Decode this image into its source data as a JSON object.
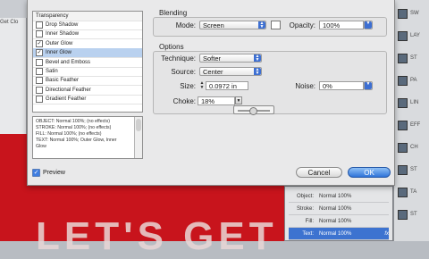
{
  "background": {
    "left_tab": "Get Clo",
    "big_text": "LET'S GET",
    "right_panel_items": [
      "SW",
      "LAY",
      "ST",
      "PA",
      "LIN",
      "EFF",
      "CH",
      "ST",
      "TA",
      "ST"
    ],
    "effects_panel": [
      {
        "label": "Object:",
        "value": "Normal 100%"
      },
      {
        "label": "Stroke:",
        "value": "Normal 100%"
      },
      {
        "label": "Fill:",
        "value": "Normal 100%"
      },
      {
        "label": "Text:",
        "value": "Normal 100%",
        "selected": true
      }
    ],
    "fx_label": "fx"
  },
  "effects_list": {
    "header": "Transparency",
    "items": [
      {
        "label": "Drop Shadow",
        "checked": false
      },
      {
        "label": "Inner Shadow",
        "checked": false
      },
      {
        "label": "Outer Glow",
        "checked": true
      },
      {
        "label": "Inner Glow",
        "checked": true,
        "selected": true
      },
      {
        "label": "Bevel and Emboss",
        "checked": false
      },
      {
        "label": "Satin",
        "checked": false
      },
      {
        "label": "Basic Feather",
        "checked": false
      },
      {
        "label": "Directional Feather",
        "checked": false
      },
      {
        "label": "Gradient Feather",
        "checked": false
      }
    ]
  },
  "summary": {
    "lines": [
      "OBJECT: Normal 100%; (no effects)",
      "STROKE: Normal 100%; (no effects)",
      "FILL: Normal 100%; (no effects)",
      "TEXT: Normal 100%; Outer Glow, Inner",
      "Glow"
    ]
  },
  "preview": {
    "label": "Preview",
    "checked": true
  },
  "blending": {
    "title": "Blending",
    "mode_label": "Mode:",
    "mode_value": "Screen",
    "opacity_label": "Opacity:",
    "opacity_value": "100%"
  },
  "options": {
    "title": "Options",
    "technique_label": "Technique:",
    "technique_value": "Softer",
    "source_label": "Source:",
    "source_value": "Center",
    "size_label": "Size:",
    "size_value": "0.0972 in",
    "noise_label": "Noise:",
    "noise_value": "0%",
    "choke_label": "Choke:",
    "choke_value": "18%",
    "choke_slider": 0.18
  },
  "buttons": {
    "cancel": "Cancel",
    "ok": "OK"
  },
  "colors": {
    "accent": "#2f73d8",
    "background_red": "#c8141c"
  }
}
